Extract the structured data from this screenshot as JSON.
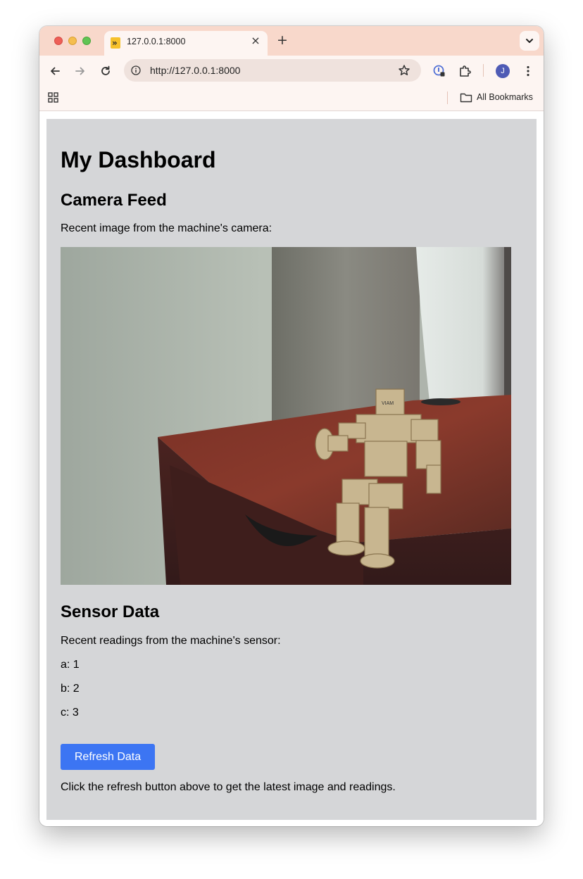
{
  "browser": {
    "tab_title": "127.0.0.1:8000",
    "url": "http://127.0.0.1:8000",
    "profile_initial": "J",
    "bookmarks_label": "All Bookmarks"
  },
  "page": {
    "title": "My Dashboard",
    "camera": {
      "heading": "Camera Feed",
      "description": "Recent image from the machine's camera:",
      "robot_label": "VIAM"
    },
    "sensor": {
      "heading": "Sensor Data",
      "description": "Recent readings from the machine's sensor:",
      "readings": [
        "a: 1",
        "b: 2",
        "c: 3"
      ]
    },
    "refresh_label": "Refresh Data",
    "footer_note": "Click the refresh button above to get the latest image and readings."
  },
  "colors": {
    "tabstrip": "#f8d8cb",
    "page_background": "#d5d6d8",
    "button": "#3c75f3"
  }
}
